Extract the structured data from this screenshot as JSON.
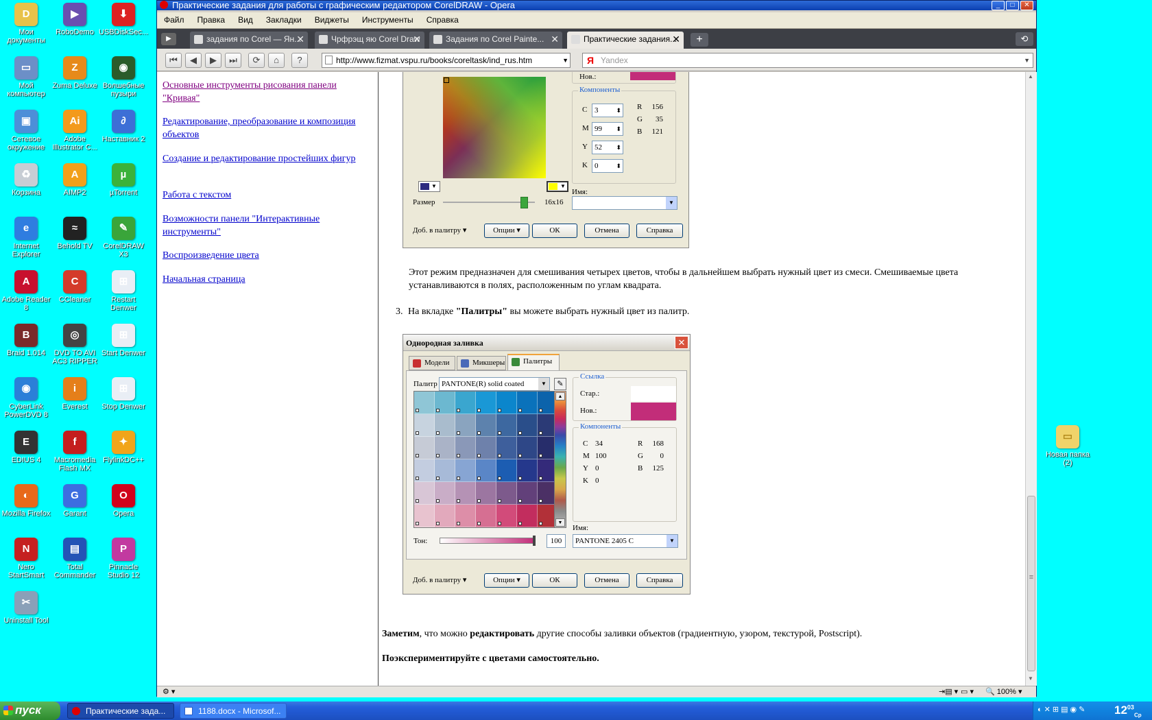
{
  "desktop": {
    "icons": [
      {
        "label": "Мои документы",
        "color": "#e8c24a",
        "glyph": "D"
      },
      {
        "label": "RoboDemo",
        "color": "#6a4fb0",
        "glyph": "▶"
      },
      {
        "label": "USBDiskSec...",
        "color": "#d22",
        "glyph": "⬇"
      },
      {
        "label": "Мой компьютер",
        "color": "#6c8fc7",
        "glyph": "▭"
      },
      {
        "label": "Zuma Deluxe",
        "color": "#e68a1a",
        "glyph": "Z"
      },
      {
        "label": "Волшебные пузыри",
        "color": "#2b5c2b",
        "glyph": "◉"
      },
      {
        "label": "Сетевое окружение",
        "color": "#4d8fd8",
        "glyph": "▣"
      },
      {
        "label": "Adobe Illustrator C...",
        "color": "#f39a1c",
        "glyph": "Ai"
      },
      {
        "label": "Наставник 2",
        "color": "#3d6fd6",
        "glyph": "∂"
      },
      {
        "label": "Корзина",
        "color": "#c7cdd4",
        "glyph": "♻"
      },
      {
        "label": "AIMP2",
        "color": "#f2a01a",
        "glyph": "A"
      },
      {
        "label": "µTorrent",
        "color": "#3bb23b",
        "glyph": "µ"
      },
      {
        "label": "Internet Explorer",
        "color": "#2f7de0",
        "glyph": "e"
      },
      {
        "label": "Behold TV",
        "color": "#222",
        "glyph": "≈"
      },
      {
        "label": "CorelDRAW X3",
        "color": "#3aa53a",
        "glyph": "✎"
      },
      {
        "label": "Adobe Reader 8",
        "color": "#c8102e",
        "glyph": "A"
      },
      {
        "label": "CCleaner",
        "color": "#d43b2a",
        "glyph": "C"
      },
      {
        "label": "Restart Denwer",
        "color": "#e9eef5",
        "glyph": "⊞"
      },
      {
        "label": "Braid 1.014",
        "color": "#7a2a2a",
        "glyph": "B"
      },
      {
        "label": "DVD TO AVI AC3 RIPPER",
        "color": "#444",
        "glyph": "◎"
      },
      {
        "label": "Start Denwer",
        "color": "#e9eef5",
        "glyph": "⊞"
      },
      {
        "label": "CyberLink PowerDVD 8",
        "color": "#2b7fd8",
        "glyph": "◉"
      },
      {
        "label": "Everest",
        "color": "#e57f1a",
        "glyph": "i"
      },
      {
        "label": "Stop Denwer",
        "color": "#e9eef5",
        "glyph": "⊞"
      },
      {
        "label": "EDIUS 4",
        "color": "#333",
        "glyph": "E"
      },
      {
        "label": "Macromedia Flash MX",
        "color": "#c41e1e",
        "glyph": "f"
      },
      {
        "label": "FlylinkDC++",
        "color": "#f1a51a",
        "glyph": "✦"
      },
      {
        "label": "Mozilla Firefox",
        "color": "#e8691a",
        "glyph": "◐"
      },
      {
        "label": "Garant",
        "color": "#3d6ee0",
        "glyph": "G"
      },
      {
        "label": "Opera",
        "color": "#d0021b",
        "glyph": "O"
      },
      {
        "label": "Nero StartSmart",
        "color": "#c52020",
        "glyph": "N"
      },
      {
        "label": "Total Commander",
        "color": "#2453b6",
        "glyph": "▤"
      },
      {
        "label": "Pinnacle Studio 12",
        "color": "#c23aa0",
        "glyph": "P"
      },
      {
        "label": "Uninstall Tool",
        "color": "#8aa0b8",
        "glyph": "✂"
      }
    ],
    "right_icon": {
      "label": "Новая папка (2)",
      "color": "#f0d36a"
    }
  },
  "browser": {
    "title": "Практические задания для работы с графическим редактором CorelDRAW - Opera",
    "menu": [
      "Файл",
      "Правка",
      "Вид",
      "Закладки",
      "Виджеты",
      "Инструменты",
      "Справка"
    ],
    "tabs": [
      {
        "label": "задания по Corel — Ян...",
        "active": false
      },
      {
        "label": "Чрфрэщ яю Corel Draw",
        "active": false
      },
      {
        "label": "Задания по Corel Painte...",
        "active": false
      },
      {
        "label": "Практические задания...",
        "active": true
      }
    ],
    "url": "http://www.fizmat.vspu.ru/books/coreltask/ind_rus.htm",
    "search_placeholder": "Yandex",
    "zoom": "100%"
  },
  "sidebar_links": [
    "Основные инструменты рисования панели \"Кривая\"",
    "Редактирование, преобразование и композиция объектов",
    "Создание и редактирование простейших фигур",
    "Работа с текстом",
    "Возможности панели \"Интерактивные инструменты\"",
    "Воспроизведение цвета",
    "Начальная страница"
  ],
  "dialog1": {
    "new_label": "Нов.:",
    "new_color": "#c22d79",
    "components_title": "Компоненты",
    "cmyk": [
      {
        "k": "C",
        "v": "3"
      },
      {
        "k": "M",
        "v": "99"
      },
      {
        "k": "Y",
        "v": "52"
      },
      {
        "k": "K",
        "v": "0"
      }
    ],
    "rgb": [
      {
        "k": "R",
        "v": "156"
      },
      {
        "k": "G",
        "v": "35"
      },
      {
        "k": "B",
        "v": "121"
      }
    ],
    "name_label": "Имя:",
    "size_label": "Размер",
    "size_value": "16x16",
    "add_palette": "Доб. в палитру",
    "options": "Опции",
    "ok": "ОК",
    "cancel": "Отмена",
    "help": "Справка"
  },
  "text": {
    "para1": "Этот режим предназначен для смешивания четырех цветов, чтобы в дальнейшем выбрать нужный цвет из смеси. Смешиваемые цвета устанавливаются в полях, расположенным по углам квадрата.",
    "item3_num": "3.",
    "item3_pre": "На вкладке ",
    "item3_bold": "\"Палитры\"",
    "item3_post": " вы можете выбрать нужный цвет из палитр.",
    "note_b1": "Заметим",
    "note_t1": ", что можно ",
    "note_b2": "редактировать",
    "note_t2": " другие способы заливки объектов (градиентную, узором, текстурой, Postscript).",
    "final": "Поэкспериментируйте с цветами самостоятельно."
  },
  "dialog2": {
    "title": "Однородная заливка",
    "tabs": [
      "Модели",
      "Микшеры",
      "Палитры"
    ],
    "palette_label": "Палитр",
    "palette_value": "PANTONE(R) solid coated",
    "ref_title": "Ссылка",
    "old_label": "Стар.:",
    "new_label": "Нов.:",
    "old_color": "#ffffff",
    "new_color": "#c22d79",
    "components_title": "Компоненты",
    "cmyk": [
      {
        "k": "C",
        "v": "34"
      },
      {
        "k": "M",
        "v": "100"
      },
      {
        "k": "Y",
        "v": "0"
      },
      {
        "k": "K",
        "v": "0"
      }
    ],
    "rgb": [
      {
        "k": "R",
        "v": "168"
      },
      {
        "k": "G",
        "v": "0"
      },
      {
        "k": "B",
        "v": "125"
      }
    ],
    "tone_label": "Тон:",
    "tone_value": "100",
    "name_label": "Имя:",
    "name_value": "PANTONE 2405 C",
    "add_palette": "Доб. в палитру",
    "options": "Опции",
    "ok": "ОК",
    "cancel": "Отмена",
    "help": "Справка",
    "swatches": [
      [
        "#8fc6d6",
        "#6cb8d0",
        "#3aa6cf",
        "#1a98d6",
        "#0b86cc",
        "#0a72bb",
        "#0c63ab"
      ],
      [
        "#c7d3df",
        "#a9bccd",
        "#8aa4bf",
        "#5d82ad",
        "#3d68a0",
        "#2a4e8a",
        "#2b3a76"
      ],
      [
        "#c6cbd6",
        "#aab3c7",
        "#8a98b8",
        "#6e81ab",
        "#3e5f9c",
        "#2e4787",
        "#272d6b"
      ],
      [
        "#c3cde0",
        "#a7bad8",
        "#87a5d3",
        "#5a86c7",
        "#1c5db2",
        "#25388c",
        "#342a7a"
      ],
      [
        "#d8c6d6",
        "#c9adc7",
        "#b592b5",
        "#9c76a1",
        "#7d5a8c",
        "#62407a",
        "#4b3065"
      ],
      [
        "#e8c3cf",
        "#e2a9bc",
        "#dd8ea8",
        "#d66f92",
        "#d24b7a",
        "#c22d5e",
        "#b23038"
      ]
    ]
  },
  "taskbar": {
    "start": "пуск",
    "tasks": [
      "Практические зада...",
      "1188.docx - Microsof..."
    ],
    "clock": "12"
  }
}
